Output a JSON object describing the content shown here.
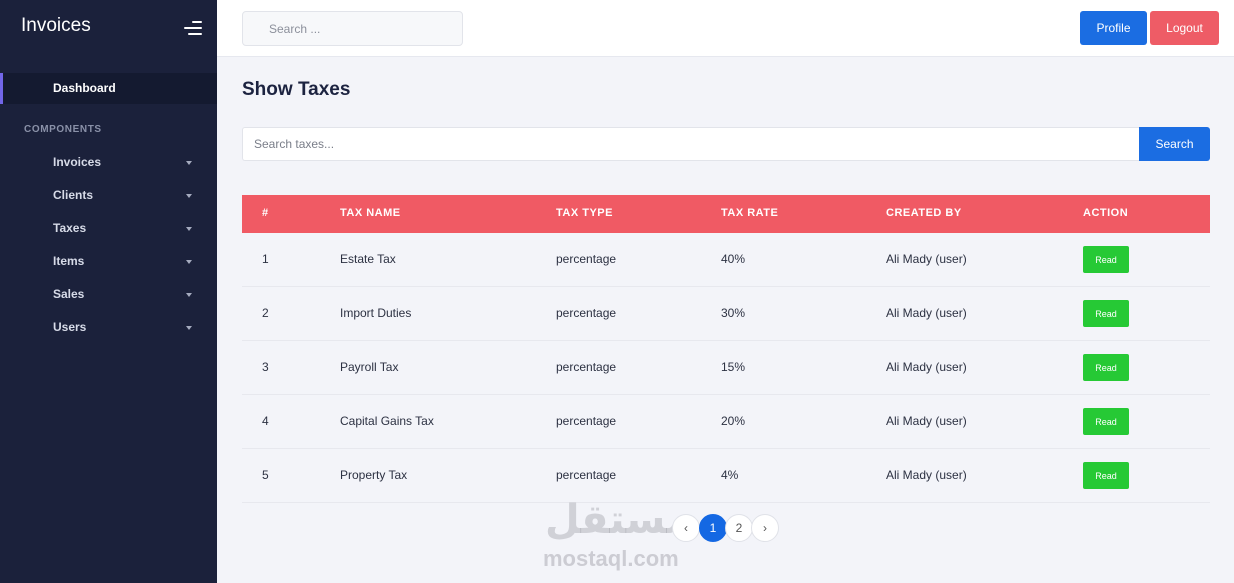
{
  "sidebar": {
    "brand": "Invoices",
    "active_item": "Dashboard",
    "section_label": "COMPONENTS",
    "items": [
      {
        "label": "Invoices"
      },
      {
        "label": "Clients"
      },
      {
        "label": "Taxes"
      },
      {
        "label": "Items"
      },
      {
        "label": "Sales"
      },
      {
        "label": "Users"
      }
    ]
  },
  "topbar": {
    "search_placeholder": "Search ...",
    "profile_label": "Profile",
    "logout_label": "Logout"
  },
  "main": {
    "title": "Show Taxes",
    "search_placeholder": "Search taxes...",
    "search_button": "Search",
    "columns": [
      "#",
      "TAX NAME",
      "TAX TYPE",
      "TAX RATE",
      "CREATED BY",
      "ACTION"
    ],
    "rows": [
      {
        "num": "1",
        "name": "Estate Tax",
        "type": "percentage",
        "rate": "40%",
        "created_by": "Ali Mady (user)",
        "action": "Read"
      },
      {
        "num": "2",
        "name": "Import Duties",
        "type": "percentage",
        "rate": "30%",
        "created_by": "Ali Mady (user)",
        "action": "Read"
      },
      {
        "num": "3",
        "name": "Payroll Tax",
        "type": "percentage",
        "rate": "15%",
        "created_by": "Ali Mady (user)",
        "action": "Read"
      },
      {
        "num": "4",
        "name": "Capital Gains Tax",
        "type": "percentage",
        "rate": "20%",
        "created_by": "Ali Mady (user)",
        "action": "Read"
      },
      {
        "num": "5",
        "name": "Property Tax",
        "type": "percentage",
        "rate": "4%",
        "created_by": "Ali Mady (user)",
        "action": "Read"
      }
    ],
    "pagination": {
      "prev": "‹",
      "pages": [
        "1",
        "2"
      ],
      "next": "›",
      "current": "1"
    }
  },
  "watermark": {
    "arabic": "مستقل",
    "latin": "mostaql.com"
  },
  "colors": {
    "sidebar_bg": "#1b213b",
    "table_header": "#f05a64",
    "primary": "#1b6de2",
    "danger": "#ee5c66",
    "success": "#26c935",
    "active_accent": "#7266e8"
  }
}
